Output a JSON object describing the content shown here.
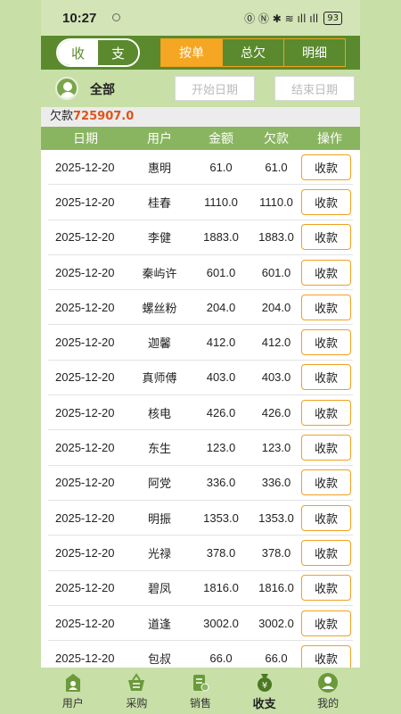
{
  "status": {
    "time": "10:27",
    "battery": "93",
    "icons": "⓪ Ⓝ ✱ ≋ ıll ıll"
  },
  "toolbar": {
    "seg": {
      "income": "收",
      "expense": "支"
    },
    "tabs": [
      {
        "label": "按单"
      },
      {
        "label": "总欠"
      },
      {
        "label": "明细"
      }
    ]
  },
  "filter": {
    "all": "全部",
    "start_placeholder": "开始日期",
    "end_placeholder": "结束日期"
  },
  "debt": {
    "label": "欠款",
    "amount": "725907.0"
  },
  "table": {
    "headers": {
      "date": "日期",
      "user": "用户",
      "amount": "金额",
      "debt": "欠款",
      "op": "操作"
    },
    "button": "收款",
    "rows": [
      {
        "date": "2025-12-20",
        "user": "惠明",
        "amount": "61.0",
        "debt": "61.0"
      },
      {
        "date": "2025-12-20",
        "user": "桂春",
        "amount": "1110.0",
        "debt": "1110.0"
      },
      {
        "date": "2025-12-20",
        "user": "李健",
        "amount": "1883.0",
        "debt": "1883.0"
      },
      {
        "date": "2025-12-20",
        "user": "秦屿许",
        "amount": "601.0",
        "debt": "601.0"
      },
      {
        "date": "2025-12-20",
        "user": "螺丝粉",
        "amount": "204.0",
        "debt": "204.0"
      },
      {
        "date": "2025-12-20",
        "user": "迦馨",
        "amount": "412.0",
        "debt": "412.0"
      },
      {
        "date": "2025-12-20",
        "user": "真师傅",
        "amount": "403.0",
        "debt": "403.0"
      },
      {
        "date": "2025-12-20",
        "user": "核电",
        "amount": "426.0",
        "debt": "426.0"
      },
      {
        "date": "2025-12-20",
        "user": "东生",
        "amount": "123.0",
        "debt": "123.0"
      },
      {
        "date": "2025-12-20",
        "user": "阿党",
        "amount": "336.0",
        "debt": "336.0"
      },
      {
        "date": "2025-12-20",
        "user": "明振",
        "amount": "1353.0",
        "debt": "1353.0"
      },
      {
        "date": "2025-12-20",
        "user": "光禄",
        "amount": "378.0",
        "debt": "378.0"
      },
      {
        "date": "2025-12-20",
        "user": "碧凤",
        "amount": "1816.0",
        "debt": "1816.0"
      },
      {
        "date": "2025-12-20",
        "user": "道逢",
        "amount": "3002.0",
        "debt": "3002.0"
      },
      {
        "date": "2025-12-20",
        "user": "包叔",
        "amount": "66.0",
        "debt": "66.0"
      }
    ]
  },
  "nav": [
    {
      "label": "用户",
      "icon": "house-user-icon"
    },
    {
      "label": "采购",
      "icon": "basket-icon"
    },
    {
      "label": "销售",
      "icon": "sales-icon"
    },
    {
      "label": "收支",
      "icon": "money-bag-icon"
    },
    {
      "label": "我的",
      "icon": "profile-icon"
    }
  ],
  "colors": {
    "primary_green": "#5a8a2d",
    "header_green": "#8ab560",
    "accent_orange": "#f0a020",
    "debt_red": "#e0531a",
    "light_green": "#c8dfa8"
  }
}
